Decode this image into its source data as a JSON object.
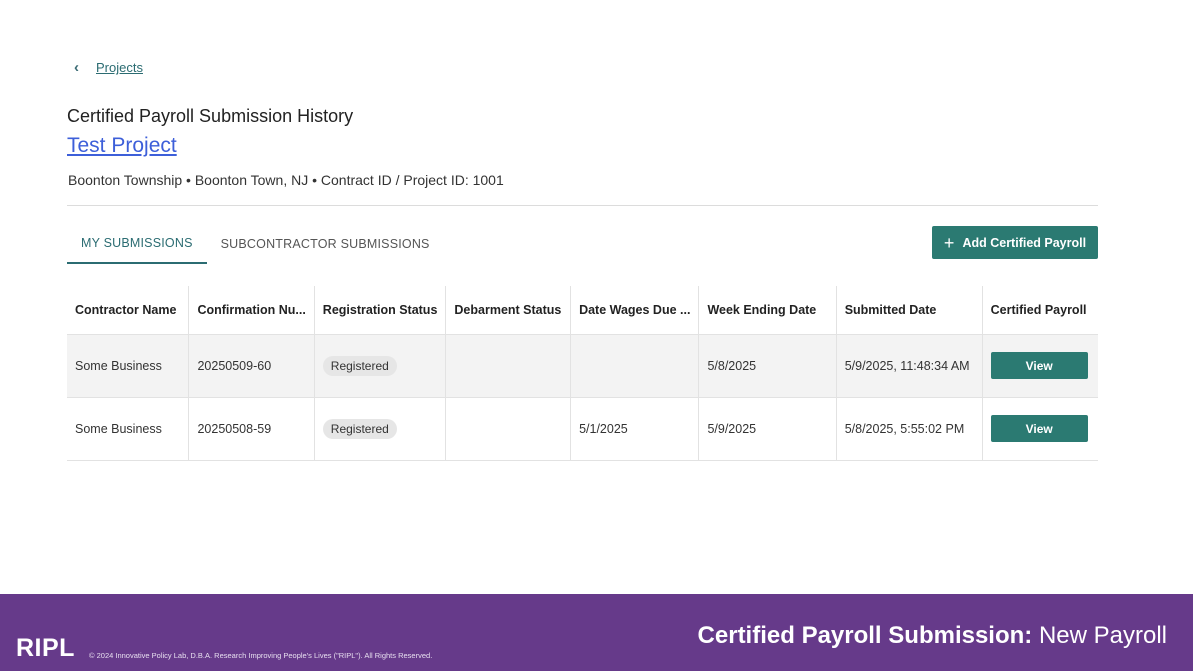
{
  "breadcrumb": {
    "chevron": "‹",
    "label": "Projects"
  },
  "page_title": "Certified Payroll Submission History",
  "project_name": "Test Project",
  "project_meta": "Boonton Township • Boonton Town, NJ • Contract ID / Project ID: 1001",
  "tabs": [
    {
      "label": "MY SUBMISSIONS",
      "active": true
    },
    {
      "label": "SUBCONTRACTOR SUBMISSIONS",
      "active": false
    }
  ],
  "add_button": {
    "icon": "+",
    "label": "Add Certified Payroll"
  },
  "table": {
    "columns": [
      "Contractor Name",
      "Confirmation Nu...",
      "Registration Status",
      "Debarment Status",
      "Date Wages Due ...",
      "Week Ending Date",
      "Submitted Date",
      "Certified Payroll"
    ],
    "rows": [
      {
        "contractor": "Some Business",
        "confirmation": "20250509-60",
        "registration": "Registered",
        "debarment": "",
        "wages_due": "",
        "week_ending": "5/8/2025",
        "submitted": "5/9/2025, 11:48:34 AM",
        "action": "View"
      },
      {
        "contractor": "Some Business",
        "confirmation": "20250508-59",
        "registration": "Registered",
        "debarment": "",
        "wages_due": "5/1/2025",
        "week_ending": "5/9/2025",
        "submitted": "5/8/2025, 5:55:02 PM",
        "action": "View"
      }
    ]
  },
  "footer": {
    "logo": "RIPL",
    "copyright": "© 2024 Innovative Policy Lab, D.B.A. Research Improving People's Lives (\"RIPL\"). All Rights Reserved.",
    "title_bold": "Certified Payroll Submission:",
    "title_rest": " New Payroll"
  },
  "colors": {
    "accent": "#2b7a72",
    "link": "#3d5fd9",
    "footer_bg": "#663a8a"
  }
}
